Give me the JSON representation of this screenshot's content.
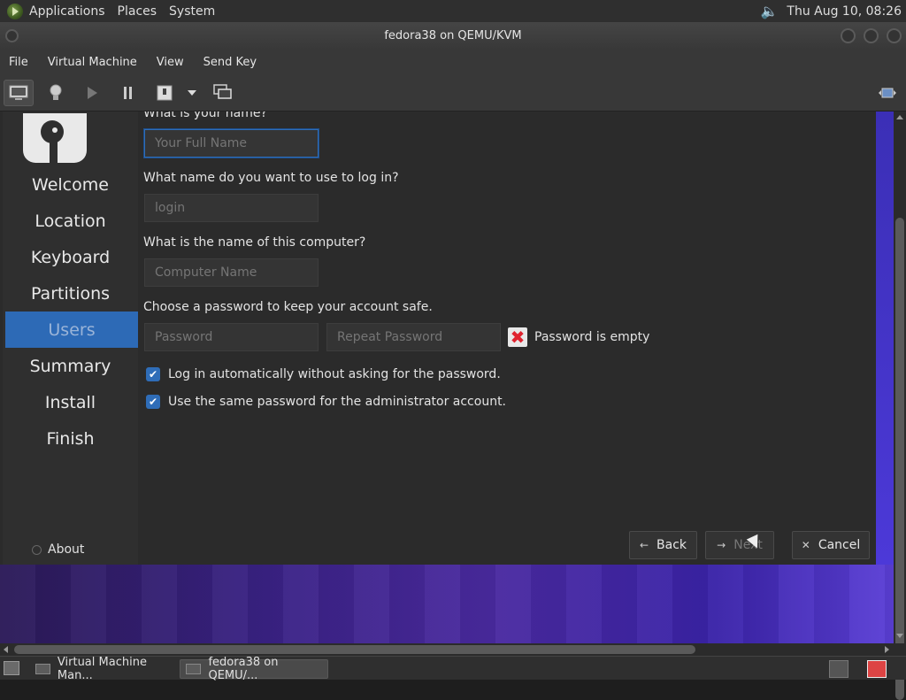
{
  "top_panel": {
    "menus": [
      "Applications",
      "Places",
      "System"
    ],
    "clock": "Thu Aug 10, 08:26"
  },
  "window": {
    "title": "fedora38 on QEMU/KVM"
  },
  "menubar": {
    "items": [
      "File",
      "Virtual Machine",
      "View",
      "Send Key"
    ]
  },
  "installer": {
    "sidebar": {
      "items": [
        "Welcome",
        "Location",
        "Keyboard",
        "Partitions",
        "Users",
        "Summary",
        "Install",
        "Finish"
      ],
      "active_index": 4,
      "about_label": "About"
    },
    "form": {
      "q_name": "What is your name?",
      "name_placeholder": "Your Full Name",
      "q_login": "What name do you want to use to log in?",
      "login_placeholder": "login",
      "q_computer": "What is the name of this computer?",
      "computer_placeholder": "Computer Name",
      "q_password": "Choose a password to keep your account safe.",
      "password_placeholder": "Password",
      "repeat_placeholder": "Repeat Password",
      "password_error": "Password is empty",
      "auto_login_label": "Log in automatically without asking for the password.",
      "same_password_label": "Use the same password for the administrator account."
    },
    "buttons": {
      "back": "Back",
      "next": "Next",
      "cancel": "Cancel"
    }
  },
  "taskbar": {
    "tasks": [
      "Virtual Machine Man...",
      "fedora38 on QEMU/..."
    ]
  },
  "colors": {
    "accent": "#2d6ab6",
    "error": "#e0232f",
    "wallpaper": "#3a2285"
  }
}
